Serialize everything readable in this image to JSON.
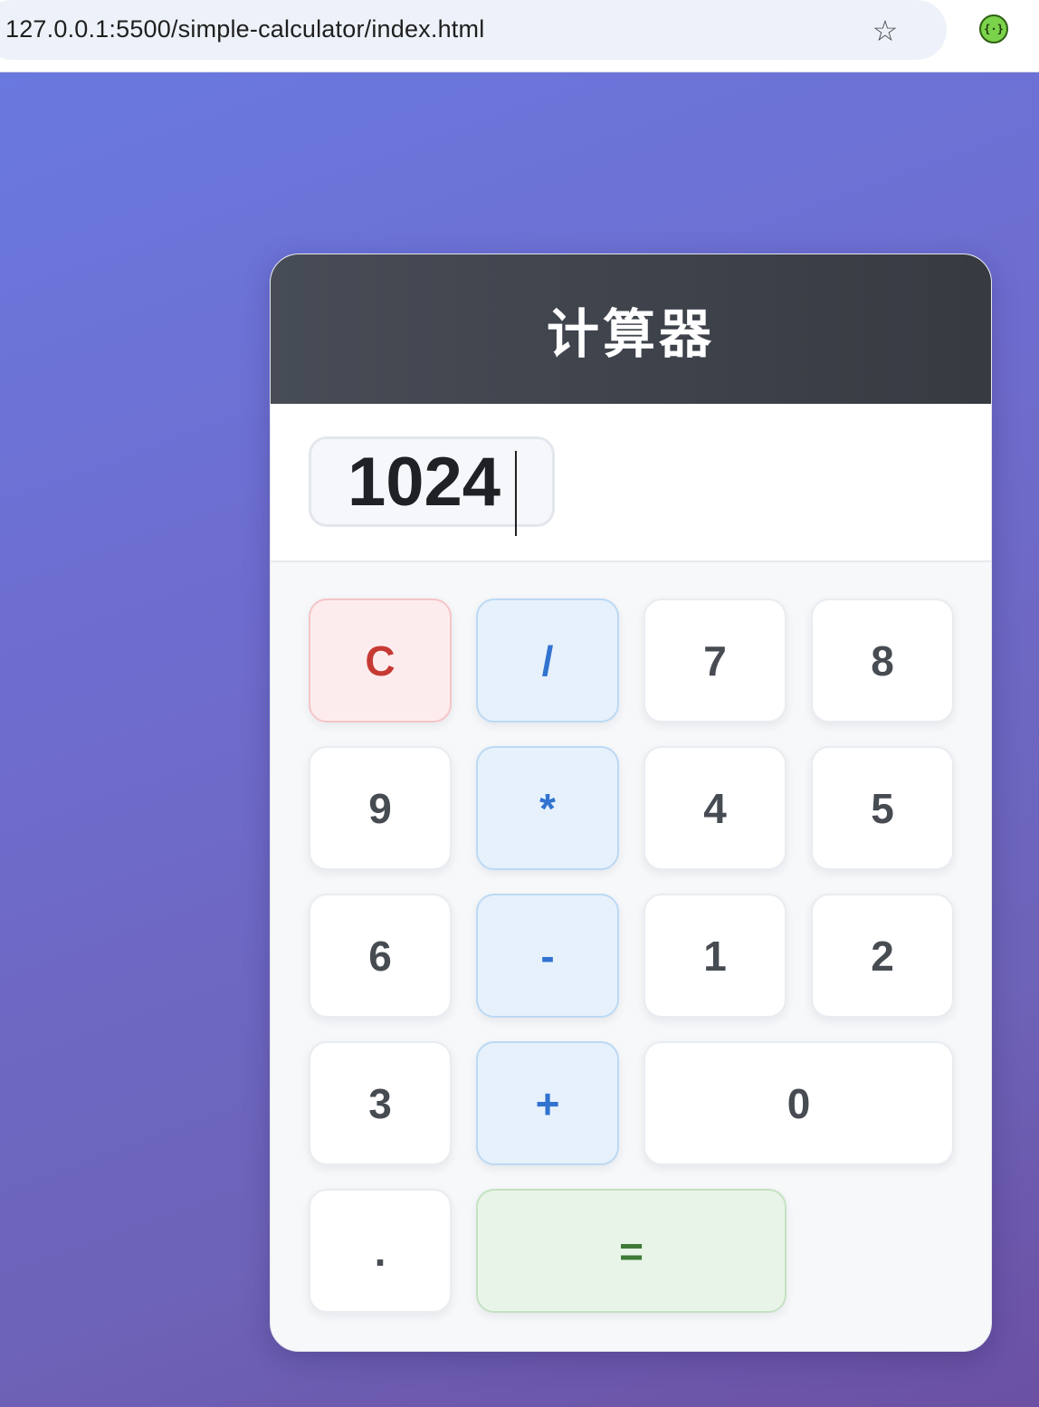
{
  "browser": {
    "url": "127.0.0.1:5500/simple-calculator/index.html",
    "bookmark_icon": "☆",
    "extension_icon": "{·}"
  },
  "calculator": {
    "title": "计算器",
    "display_value": "1024",
    "keys": [
      {
        "label": "C",
        "kind": "clear"
      },
      {
        "label": "/",
        "kind": "op"
      },
      {
        "label": "7",
        "kind": "num"
      },
      {
        "label": "8",
        "kind": "num"
      },
      {
        "label": "9",
        "kind": "num"
      },
      {
        "label": "*",
        "kind": "op"
      },
      {
        "label": "4",
        "kind": "num"
      },
      {
        "label": "5",
        "kind": "num"
      },
      {
        "label": "6",
        "kind": "num"
      },
      {
        "label": "-",
        "kind": "op"
      },
      {
        "label": "1",
        "kind": "num"
      },
      {
        "label": "2",
        "kind": "num"
      },
      {
        "label": "3",
        "kind": "num"
      },
      {
        "label": "+",
        "kind": "op"
      },
      {
        "label": "0",
        "kind": "num"
      },
      {
        "label": ".",
        "kind": "num"
      },
      {
        "label": "=",
        "kind": "equals"
      }
    ]
  },
  "colors": {
    "header_bg": "#404349",
    "clear_text": "#c73a34",
    "operator_text": "#3273d0",
    "equals_text": "#3d7a37"
  }
}
